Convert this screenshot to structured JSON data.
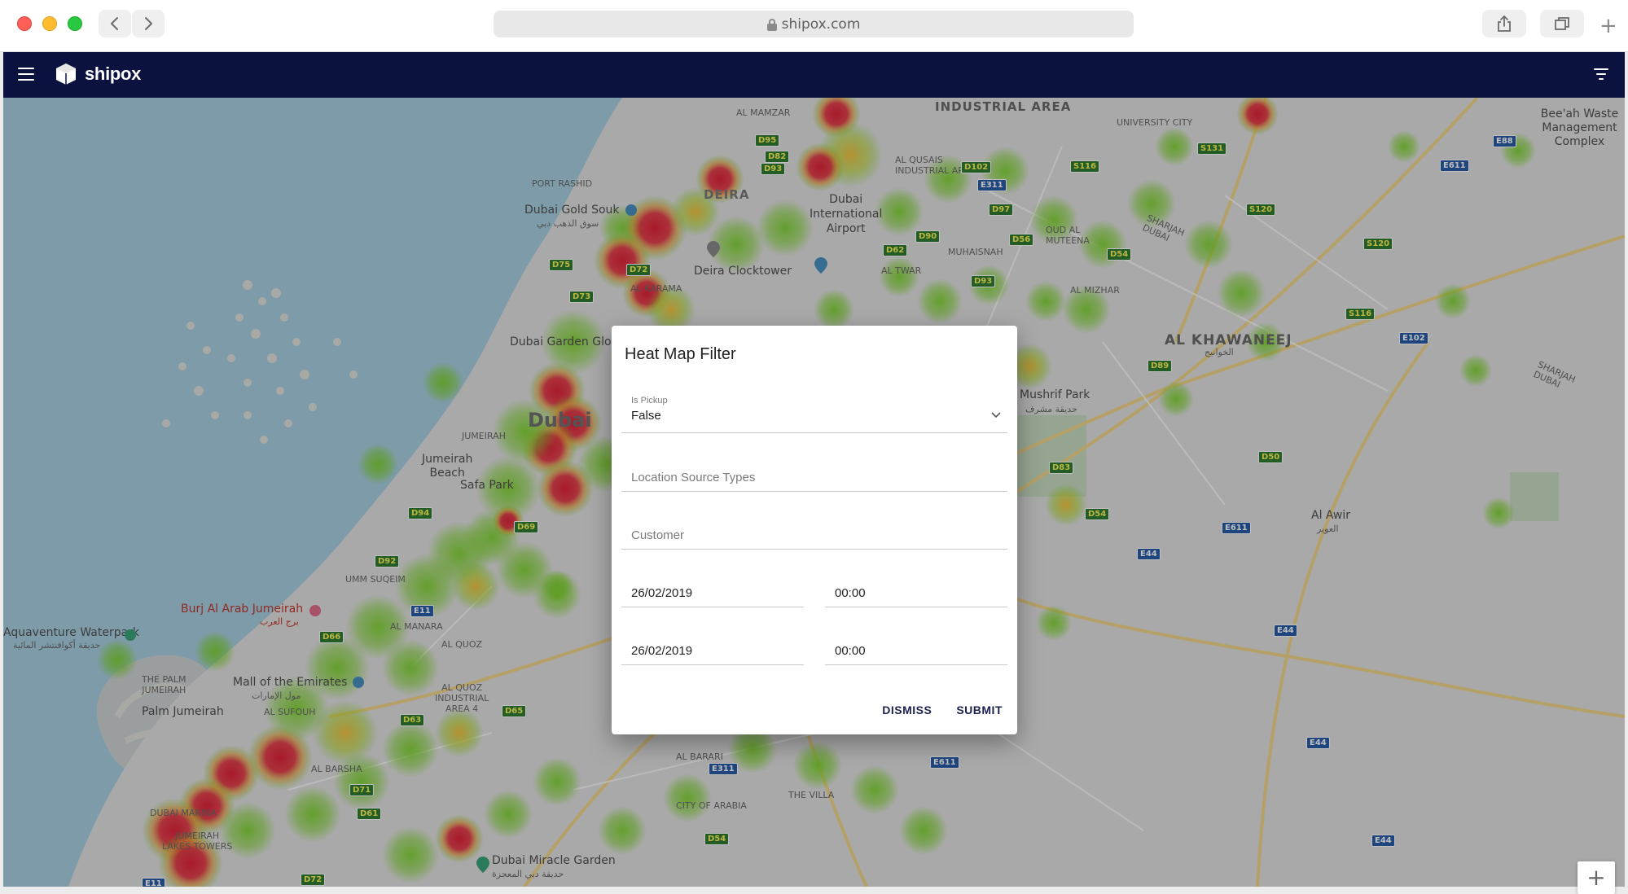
{
  "browser": {
    "url": "shipox.com"
  },
  "app": {
    "brand": "shipox",
    "header_color": "#0b1240"
  },
  "icons": {
    "menu": "hamburger-menu-icon",
    "filter": "filter-list-icon",
    "back": "chevron-left-icon",
    "forward": "chevron-right-icon",
    "share": "share-icon",
    "tabs": "tabs-overview-icon",
    "new_tab": "plus-icon",
    "lock": "lock-icon",
    "zoom_in": "plus-icon"
  },
  "map": {
    "labels": {
      "industrial_area": "INDUSTRIAL AREA",
      "al_mamzar": "AL MAMZAR",
      "university_city": "UNIVERSITY CITY",
      "beeah": "Bee'ah Waste\nManagement Complex",
      "port_rashid": "PORT RASHID",
      "deira": "DEIRA",
      "dubai_gold_souk": "Dubai Gold Souk",
      "dubai_gold_souk_ar": "سوق الذهب دبي",
      "dubai_airport": "Dubai\nInternational\nAirport",
      "deira_clocktower": "Deira Clocktower",
      "al_khawaneej": "AL KHAWANEEJ",
      "al_khawaneej_ar": "الخوانيج",
      "dubai_garden_glow": "Dubai Garden Glow",
      "dubai": "Dubai",
      "jumeirah": "JUMEIRAH",
      "jumeirah_beach": "Jumeirah\nBeach",
      "safa_park": "Safa Park",
      "mushrif_park": "Mushrif Park",
      "mushrif_park_ar": "حديقة مشرف",
      "al_awir": "Al Awir",
      "al_awir_ar": "العوير",
      "umm_suqeim": "UMM SUQEIM",
      "burj_al_arab": "Burj Al Arab Jumeirah",
      "burj_al_arab_ar": "برج العرب",
      "aquaventure": "Aquaventure Waterpark",
      "aquaventure_ar": "حديقة أكوافنتشر المائية",
      "al_manara": "AL MANARA",
      "al_quoz": "AL QUOZ",
      "mall_of_emirates": "Mall of the Emirates",
      "mall_of_emirates_ar": "مول الإمارات",
      "the_palm_jumeirah": "THE PALM\nJUMEIRAH",
      "palm_jumeirah": "Palm Jumeirah",
      "al_sufouh": "AL SUFOUH",
      "al_barsha": "AL BARSHA",
      "al_quoz_industrial": "AL QUOZ\nINDUSTRIAL\nAREA 4",
      "dubai_marina": "DUBAI MARINA",
      "jumeirah_lake_towers": "JUMEIRAH\nLAKES TOWERS",
      "al_barari": "AL BARARI",
      "city_of_arabia": "CITY OF ARABIA",
      "the_villa": "THE VILLA",
      "dubai_miracle_garden": "Dubai Miracle Garden",
      "dubai_miracle_garden_ar": "حديقة دبي المعجزة",
      "al_twar": "AL TWAR",
      "muhaisnah": "MUHAISNAH",
      "al_mizhar": "AL MIZHAR",
      "oud_al_muteena": "OUD AL\nMUTEENA",
      "al_karama": "AL KARAMA",
      "al_qusais": "AL QUSAIS\nINDUSTRIAL AREA",
      "sharjah_dubai_1": "SHARJAH\nDUBAI",
      "sharjah_dubai_2": "SHARJAH\nDUBAI"
    },
    "routes": [
      "D95",
      "D82",
      "D93",
      "E311",
      "S116",
      "S131",
      "D102",
      "D97",
      "D56",
      "D54",
      "D93",
      "S120",
      "E611",
      "E88",
      "D75",
      "D72",
      "D73",
      "D62",
      "D90",
      "D89",
      "E102",
      "S120",
      "D50",
      "D83",
      "D54",
      "E44",
      "E611",
      "E44",
      "D94",
      "D69",
      "D92",
      "E11",
      "D66",
      "D63",
      "D65",
      "D71",
      "D61",
      "E311",
      "E611",
      "D54",
      "E11",
      "D72",
      "E44",
      "E44",
      "S116"
    ]
  },
  "dialog": {
    "title": "Heat Map Filter",
    "is_pickup": {
      "label": "Is Pickup",
      "value": "False"
    },
    "location_source_types": {
      "placeholder": "Location Source Types"
    },
    "customer": {
      "placeholder": "Customer"
    },
    "from": {
      "date": "26/02/2019",
      "time": "00:00"
    },
    "to": {
      "date": "26/02/2019",
      "time": "00:00"
    },
    "dismiss_label": "DISMISS",
    "submit_label": "SUBMIT"
  },
  "zoom": {
    "in_label": "+"
  }
}
